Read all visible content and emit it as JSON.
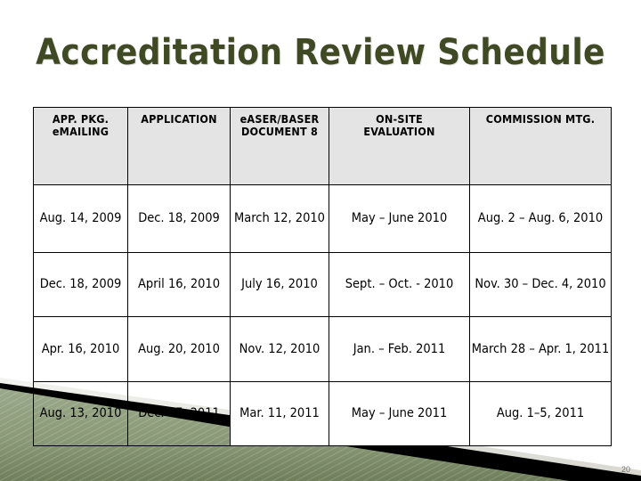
{
  "slide": {
    "title": "Accreditation Review Schedule",
    "title_color": "#3f4a24",
    "page_number": "20",
    "background_color": "#ffffff"
  },
  "decor": {
    "name": "corner-wedge-graphic",
    "green": "#8c9b79",
    "green_dark": "#76855f",
    "black": "#000000",
    "light": "#e9e9e4"
  },
  "table": {
    "header_background": "#e4e4e4",
    "border_color": "#000000",
    "columns": [
      "APP. PKG. eMAILING",
      "APPLICATION",
      "eASER/BASER DOCUMENT 8",
      "ON-SITE EVALUATION",
      "COMMISSION MTG."
    ],
    "columns_lines": [
      [
        "APP. PKG.",
        "eMAILING"
      ],
      [
        "APPLICATION"
      ],
      [
        "eASER/BASER",
        "DOCUMENT 8"
      ],
      [
        "ON-SITE",
        "EVALUATION"
      ],
      [
        "COMMISSION MTG."
      ]
    ],
    "rows": [
      {
        "app_pkg_emailing": "Aug. 14, 2009",
        "application": "Dec. 18, 2009",
        "easer_baser_document": "March 12, 2010",
        "on_site_evaluation": "May – June 2010",
        "commission_mtg": "Aug. 2 – Aug. 6, 2010"
      },
      {
        "app_pkg_emailing": "Dec. 18, 2009",
        "application": "April 16, 2010",
        "easer_baser_document": "July 16, 2010",
        "on_site_evaluation": "Sept. –  Oct. - 2010",
        "commission_mtg": "Nov. 30 – Dec. 4, 2010"
      },
      {
        "app_pkg_emailing": "Apr. 16, 2010",
        "application": "Aug. 20, 2010",
        "easer_baser_document": "Nov. 12, 2010",
        "on_site_evaluation": "Jan. – Feb. 2011",
        "commission_mtg": "March 28 –  Apr. 1, 2011"
      },
      {
        "app_pkg_emailing": "Aug. 13, 2010",
        "application": "Dec. 17, 2011",
        "easer_baser_document": "Mar. 11, 2011",
        "on_site_evaluation": "May – June 2011",
        "commission_mtg": "Aug. 1–5, 2011"
      }
    ]
  }
}
